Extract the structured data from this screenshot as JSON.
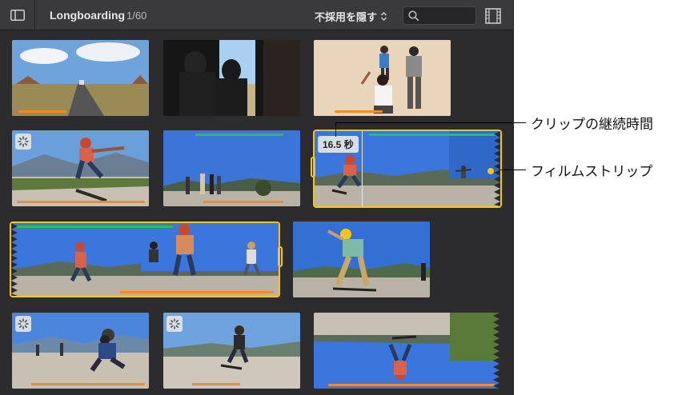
{
  "toolbar": {
    "library_title": "Longboarding",
    "selection_count": "1/60",
    "filter_label": "不採用を隠す",
    "search_placeholder": ""
  },
  "icons": {
    "sidebar_toggle": "sidebar-icon",
    "filter_updown": "chevron-updown-icon",
    "search": "search-icon",
    "filmstrip_view": "filmstrip-icon",
    "analyzing": "spinner-icon"
  },
  "selected_clip": {
    "duration_badge": "16.5 秒"
  },
  "callouts": {
    "duration": "クリップの継続時間",
    "filmstrip": "フィルムストリップ"
  },
  "colors": {
    "selection": "#f5c518",
    "favorite_bar": "#2fbf4a",
    "keyword_bar": "#f08c2a",
    "browser_bg": "#2c2c2e"
  }
}
